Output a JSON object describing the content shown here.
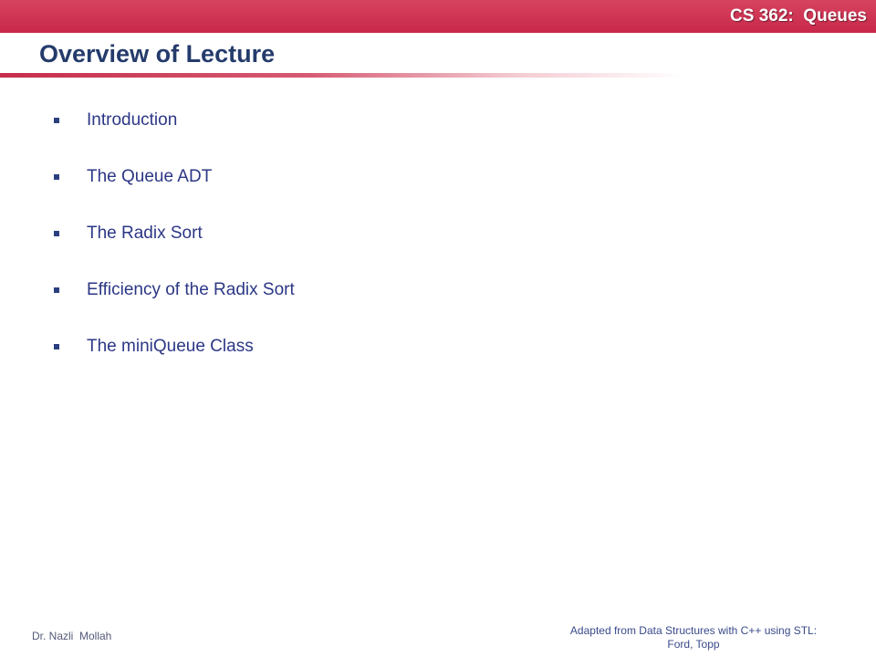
{
  "header": {
    "course_title": "CS 362:  Queues"
  },
  "slide": {
    "title": "Overview of Lecture",
    "bullets": [
      {
        "text": "Introduction"
      },
      {
        "text": "The Queue ADT"
      },
      {
        "text": "The Radix Sort"
      },
      {
        "text": "Efficiency of the Radix Sort"
      },
      {
        "text": "The miniQueue Class"
      }
    ]
  },
  "footer": {
    "author": "Dr. Nazli  Mollah",
    "credit_line1": "Adapted from Data Structures with C++ using STL:",
    "credit_line2": "Ford, Topp"
  },
  "colors": {
    "header_bar": "#c8284a",
    "title": "#243b6b",
    "bullet_text": "#2c3786"
  }
}
